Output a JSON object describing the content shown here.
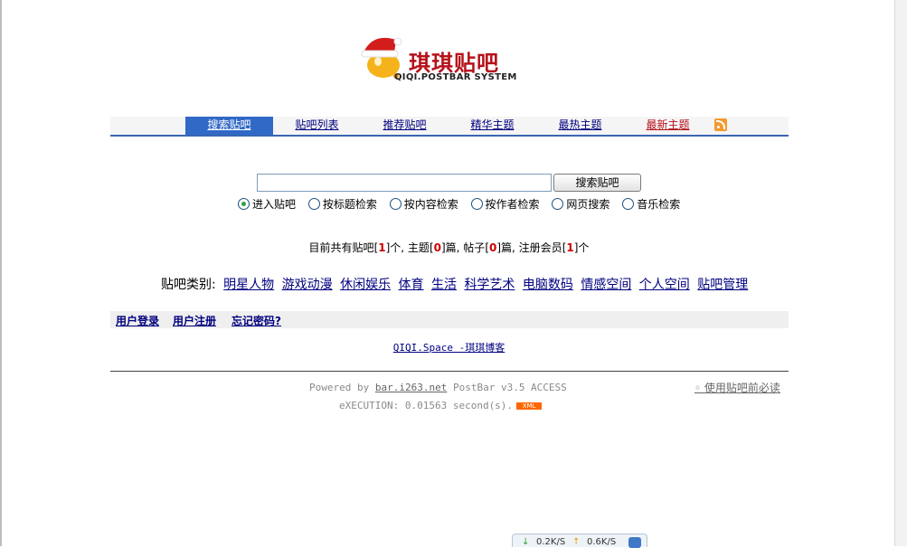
{
  "logo": {
    "title": "琪琪贴吧",
    "subtitle": "QIQI.POSTBAR SYSTEM"
  },
  "nav": {
    "items": [
      {
        "label": "搜索贴吧",
        "state": "active"
      },
      {
        "label": "贴吧列表",
        "state": "normal"
      },
      {
        "label": "推荐贴吧",
        "state": "normal"
      },
      {
        "label": "精华主题",
        "state": "normal"
      },
      {
        "label": "最热主题",
        "state": "normal"
      },
      {
        "label": "最新主题",
        "state": "highlight"
      }
    ],
    "rss_icon": "rss-icon",
    "colors": {
      "active_bg": "#3169c6",
      "link": "#00007f",
      "highlight": "#b5121b"
    }
  },
  "search": {
    "input_value": "",
    "button_label": "搜索贴吧",
    "options": [
      "进入贴吧",
      "按标题检索",
      "按内容检索",
      "按作者检索",
      "网页搜索",
      "音乐检索"
    ],
    "selected": "进入贴吧"
  },
  "stats": {
    "prefix": "目前共有贴吧",
    "bars": "1",
    "unit_bars": "个, 主题",
    "topics": "0",
    "unit_topics": "篇, 帖子",
    "posts": "0",
    "unit_posts": "篇, 注册会员",
    "members": "1",
    "unit_members": "个"
  },
  "categories": {
    "label": "贴吧类别:",
    "items": [
      "明星人物",
      "游戏动漫",
      "休闲娱乐",
      "体育",
      "生活",
      "科学艺术",
      "电脑数码",
      "情感空间",
      "个人空间",
      "贴吧管理"
    ]
  },
  "userbar": {
    "login": "用户登录",
    "register": "用户注册",
    "forgot": "忘记密码?"
  },
  "blog_link": "QIQI.Space -琪琪博客",
  "footer": {
    "powered_prefix": "Powered by",
    "powered_link": "bar.i263.net",
    "powered_suffix": "PostBar v3.5 ACCESS",
    "execution": "eXECUTION: 0.01563 second(s).",
    "xml_badge": "XML",
    "readme": "使用贴吧前必读"
  },
  "speed_widget": {
    "down": "0.2K/S",
    "up": "0.6K/S"
  }
}
